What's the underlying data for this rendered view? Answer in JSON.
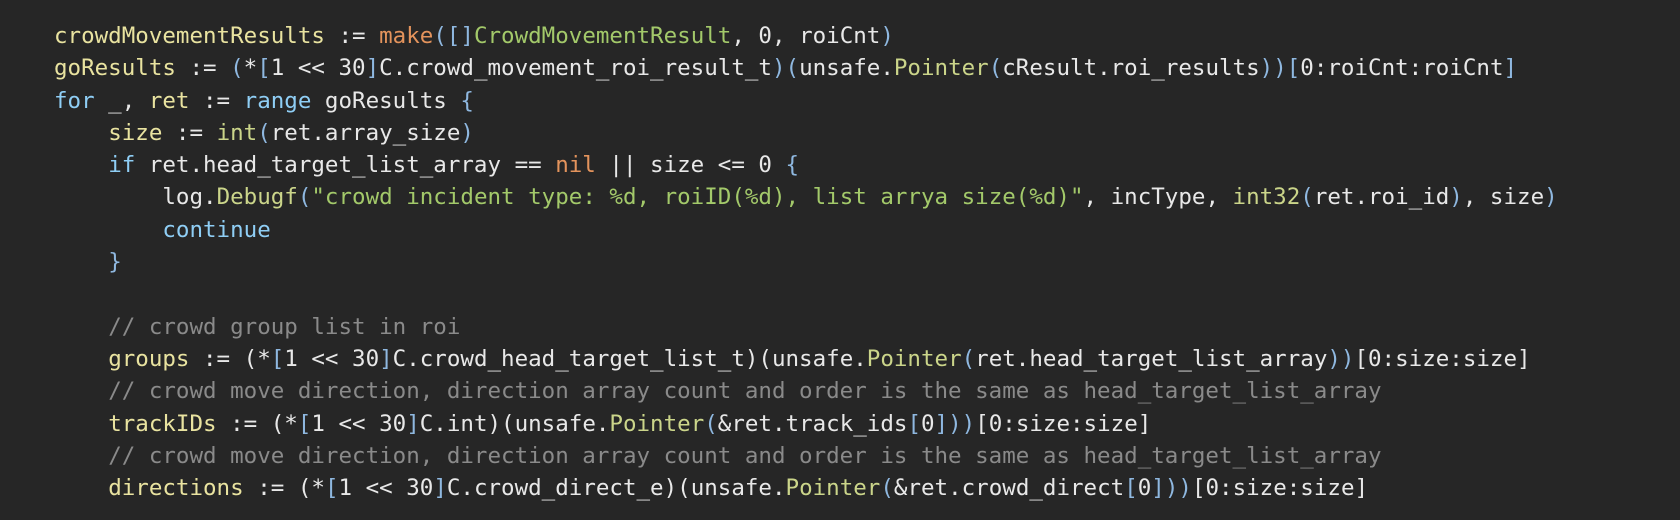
{
  "colors": {
    "background": "#262626",
    "plain": "#e8e8e8",
    "variable": "#e9e3a0",
    "builtin": "#e3935c",
    "type": "#a3c96a",
    "keyword": "#8fcef5",
    "call": "#cbd58a",
    "string": "#a3c96a",
    "comment": "#8a8a8a",
    "bracket": "#8fb8e0"
  },
  "code_lines": [
    [
      {
        "t": "crowdMovementResults",
        "k": "var"
      },
      {
        "t": " := ",
        "k": "plain"
      },
      {
        "t": "make",
        "k": "builtin"
      },
      {
        "t": "(",
        "k": "bracket"
      },
      {
        "t": "[]",
        "k": "bracket"
      },
      {
        "t": "CrowdMovementResult",
        "k": "type"
      },
      {
        "t": ", 0, roiCnt",
        "k": "plain"
      },
      {
        "t": ")",
        "k": "bracket"
      }
    ],
    [
      {
        "t": "goResults",
        "k": "var"
      },
      {
        "t": " := ",
        "k": "plain"
      },
      {
        "t": "(",
        "k": "bracket"
      },
      {
        "t": "*",
        "k": "plain"
      },
      {
        "t": "[",
        "k": "bracket"
      },
      {
        "t": "1 << 30",
        "k": "plain"
      },
      {
        "t": "]",
        "k": "bracket"
      },
      {
        "t": "C.crowd_movement_roi_result_t",
        "k": "plain"
      },
      {
        "t": ")(",
        "k": "bracket"
      },
      {
        "t": "unsafe.",
        "k": "plain"
      },
      {
        "t": "Pointer",
        "k": "call"
      },
      {
        "t": "(",
        "k": "bracket"
      },
      {
        "t": "cResult.roi_results",
        "k": "plain"
      },
      {
        "t": "))",
        "k": "bracket"
      },
      {
        "t": "[",
        "k": "bracket"
      },
      {
        "t": "0:roiCnt:roiCnt",
        "k": "plain"
      },
      {
        "t": "]",
        "k": "bracket"
      }
    ],
    [
      {
        "t": "for",
        "k": "keyword"
      },
      {
        "t": " _, ",
        "k": "plain"
      },
      {
        "t": "ret",
        "k": "var"
      },
      {
        "t": " := ",
        "k": "plain"
      },
      {
        "t": "range",
        "k": "keyword"
      },
      {
        "t": " goResults ",
        "k": "plain"
      },
      {
        "t": "{",
        "k": "bracket"
      }
    ],
    [
      {
        "t": "    ",
        "k": "plain"
      },
      {
        "t": "size",
        "k": "var"
      },
      {
        "t": " := ",
        "k": "plain"
      },
      {
        "t": "int",
        "k": "call"
      },
      {
        "t": "(",
        "k": "bracket"
      },
      {
        "t": "ret.array_size",
        "k": "plain"
      },
      {
        "t": ")",
        "k": "bracket"
      }
    ],
    [
      {
        "t": "    ",
        "k": "plain"
      },
      {
        "t": "if",
        "k": "keyword"
      },
      {
        "t": " ret.head_target_list_array == ",
        "k": "plain"
      },
      {
        "t": "nil",
        "k": "nil"
      },
      {
        "t": " || size <= 0 ",
        "k": "plain"
      },
      {
        "t": "{",
        "k": "bracket"
      }
    ],
    [
      {
        "t": "        log.",
        "k": "plain"
      },
      {
        "t": "Debugf",
        "k": "call"
      },
      {
        "t": "(",
        "k": "bracket"
      },
      {
        "t": "\"crowd incident type: %d, roiID(%d), list arrya size(%d)\"",
        "k": "string"
      },
      {
        "t": ", incType, ",
        "k": "plain"
      },
      {
        "t": "int32",
        "k": "call"
      },
      {
        "t": "(",
        "k": "bracket"
      },
      {
        "t": "ret.roi_id",
        "k": "plain"
      },
      {
        "t": ")",
        "k": "bracket"
      },
      {
        "t": ", size",
        "k": "plain"
      },
      {
        "t": ")",
        "k": "bracket"
      }
    ],
    [
      {
        "t": "        ",
        "k": "plain"
      },
      {
        "t": "continue",
        "k": "keyword"
      }
    ],
    [
      {
        "t": "    ",
        "k": "plain"
      },
      {
        "t": "}",
        "k": "bracket"
      }
    ],
    [
      {
        "t": "",
        "k": "plain"
      }
    ],
    [
      {
        "t": "    ",
        "k": "plain"
      },
      {
        "t": "// crowd group list in roi",
        "k": "comment"
      }
    ],
    [
      {
        "t": "    ",
        "k": "plain"
      },
      {
        "t": "groups",
        "k": "var"
      },
      {
        "t": " := (*",
        "k": "plain"
      },
      {
        "t": "[",
        "k": "bracket"
      },
      {
        "t": "1 << 30",
        "k": "plain"
      },
      {
        "t": "]",
        "k": "bracket"
      },
      {
        "t": "C.crowd_head_target_list_t",
        "k": "plain"
      },
      {
        "t": ")(",
        "k": "plain"
      },
      {
        "t": "unsafe.",
        "k": "plain"
      },
      {
        "t": "Pointer",
        "k": "call"
      },
      {
        "t": "(",
        "k": "bracket"
      },
      {
        "t": "ret.head_target_list_array",
        "k": "plain"
      },
      {
        "t": "))",
        "k": "bracket"
      },
      {
        "t": "[0:size:size]",
        "k": "plain"
      }
    ],
    [
      {
        "t": "    ",
        "k": "plain"
      },
      {
        "t": "// crowd move direction, direction array count and order is the same as head_target_list_array",
        "k": "comment"
      }
    ],
    [
      {
        "t": "    ",
        "k": "plain"
      },
      {
        "t": "trackIDs",
        "k": "var"
      },
      {
        "t": " := (*",
        "k": "plain"
      },
      {
        "t": "[",
        "k": "bracket"
      },
      {
        "t": "1 << 30",
        "k": "plain"
      },
      {
        "t": "]",
        "k": "bracket"
      },
      {
        "t": "C.int",
        "k": "plain"
      },
      {
        "t": ")(",
        "k": "plain"
      },
      {
        "t": "unsafe.",
        "k": "plain"
      },
      {
        "t": "Pointer",
        "k": "call"
      },
      {
        "t": "(",
        "k": "bracket"
      },
      {
        "t": "&ret.track_ids",
        "k": "plain"
      },
      {
        "t": "[",
        "k": "bracket"
      },
      {
        "t": "0",
        "k": "plain"
      },
      {
        "t": "]",
        "k": "bracket"
      },
      {
        "t": "))",
        "k": "bracket"
      },
      {
        "t": "[0:size:size]",
        "k": "plain"
      }
    ],
    [
      {
        "t": "    ",
        "k": "plain"
      },
      {
        "t": "// crowd move direction, direction array count and order is the same as head_target_list_array",
        "k": "comment"
      }
    ],
    [
      {
        "t": "    ",
        "k": "plain"
      },
      {
        "t": "directions",
        "k": "var"
      },
      {
        "t": " := (*",
        "k": "plain"
      },
      {
        "t": "[",
        "k": "bracket"
      },
      {
        "t": "1 << 30",
        "k": "plain"
      },
      {
        "t": "]",
        "k": "bracket"
      },
      {
        "t": "C.crowd_direct_e",
        "k": "plain"
      },
      {
        "t": ")(",
        "k": "plain"
      },
      {
        "t": "unsafe.",
        "k": "plain"
      },
      {
        "t": "Pointer",
        "k": "call"
      },
      {
        "t": "(",
        "k": "bracket"
      },
      {
        "t": "&ret.crowd_direct",
        "k": "plain"
      },
      {
        "t": "[",
        "k": "bracket"
      },
      {
        "t": "0",
        "k": "plain"
      },
      {
        "t": "]",
        "k": "bracket"
      },
      {
        "t": "))",
        "k": "bracket"
      },
      {
        "t": "[0:size:size]",
        "k": "plain"
      }
    ]
  ]
}
